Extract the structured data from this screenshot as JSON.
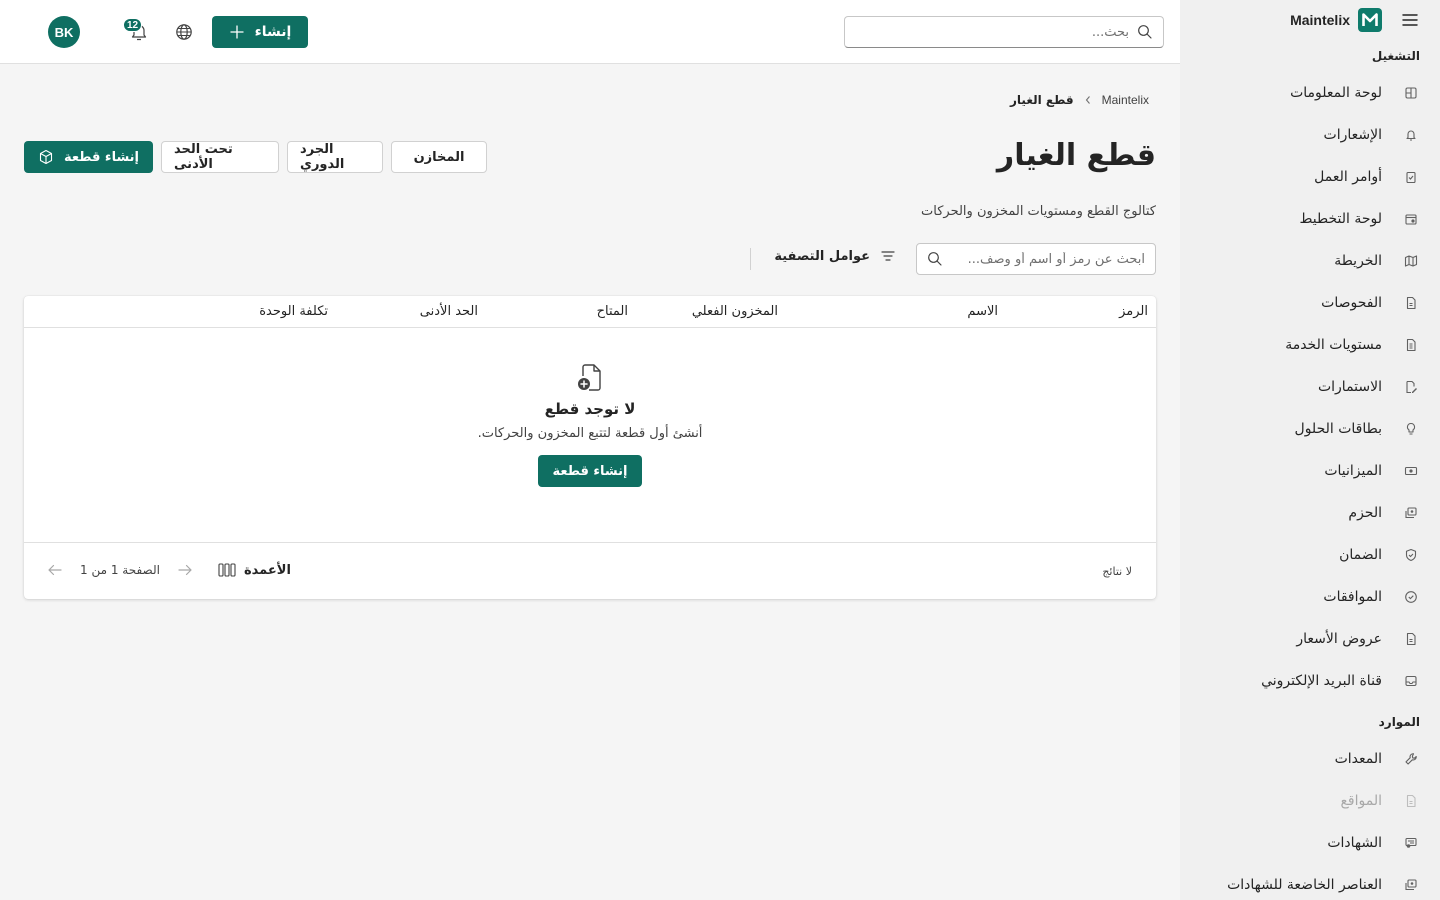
{
  "app": {
    "name": "Maintelix",
    "brand_color": "#0f6f62"
  },
  "sidebar": {
    "sections": [
      {
        "title": "التشغيل"
      },
      {
        "title": "الموارد"
      }
    ],
    "items": [
      {
        "label": "لوحة المعلومات",
        "icon": "dashboard-icon"
      },
      {
        "label": "الإشعارات",
        "icon": "bell-icon"
      },
      {
        "label": "أوامر العمل",
        "icon": "clipboard-icon"
      },
      {
        "label": "لوحة التخطيط",
        "icon": "calendar-icon"
      },
      {
        "label": "الخريطة",
        "icon": "map-icon"
      },
      {
        "label": "الفحوصات",
        "icon": "document-icon"
      },
      {
        "label": "مستويات الخدمة",
        "icon": "document-icon"
      },
      {
        "label": "الاستمارات",
        "icon": "form-edit-icon"
      },
      {
        "label": "بطاقات الحلول",
        "icon": "lightbulb-icon"
      },
      {
        "label": "الميزانيات",
        "icon": "money-icon"
      },
      {
        "label": "الحزم",
        "icon": "box-multiple-icon"
      },
      {
        "label": "الضمان",
        "icon": "shield-check-icon"
      },
      {
        "label": "الموافقات",
        "icon": "checkmark-circle-icon"
      },
      {
        "label": "عروض الأسعار",
        "icon": "document-icon"
      },
      {
        "label": "قناة البريد الإلكتروني",
        "icon": "mail-icon"
      },
      {
        "label": "المعدات",
        "icon": "wrench-icon"
      },
      {
        "label": "المواقع",
        "icon": "building-icon"
      },
      {
        "label": "الشهادات",
        "icon": "certificate-icon"
      },
      {
        "label": "العناصر الخاضعة للشهادات",
        "icon": "box-multiple-icon"
      }
    ]
  },
  "topbar": {
    "search_placeholder": "بحث...",
    "create_label": "إنشاء",
    "notification_count": "12",
    "avatar_initials": "BK"
  },
  "breadcrumb": {
    "root": "Maintelix",
    "current": "قطع الغيار"
  },
  "page": {
    "title": "قطع الغيار",
    "subtitle": "كتالوج القطع ومستويات المخزون والحركات",
    "actions": {
      "warehouses": "المخازن",
      "cycle_count": "الجرد الدوري",
      "below_min": "تحت الحد الأدنى",
      "create_part": "إنشاء قطعة"
    }
  },
  "list": {
    "search_placeholder": "ابحث عن رمز أو اسم أو وصف...",
    "filters_label": "عوامل التصفية",
    "columns": [
      "الرمز",
      "الاسم",
      "المخزون الفعلي",
      "المتاح",
      "الحد الأدنى",
      "تكلفة الوحدة"
    ],
    "empty": {
      "title": "لا توجد قطع",
      "description": "أنشئ أول قطعة لتتبع المخزون والحركات.",
      "button": "إنشاء قطعة"
    },
    "footer": {
      "results": "لا نتائج",
      "columns_label": "الأعمدة",
      "page_info": "الصفحة 1 من 1"
    }
  }
}
